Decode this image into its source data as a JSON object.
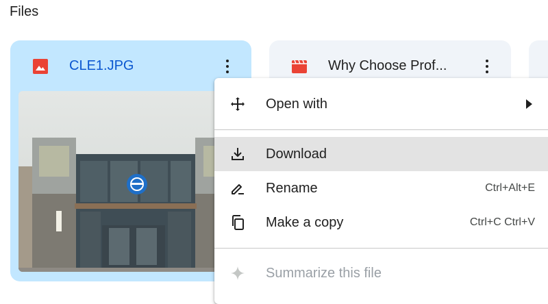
{
  "section": {
    "title": "Files"
  },
  "cards": [
    {
      "name": "CLE1.JPG",
      "type_icon": "image-file-icon",
      "more_icon": "more-vert-icon"
    },
    {
      "name": "Why Choose Prof...",
      "type_icon": "video-file-icon",
      "more_icon": "more-vert-icon"
    }
  ],
  "menu": {
    "items": [
      {
        "label": "Open with",
        "icon": "open-with-icon",
        "submenu": true
      },
      {
        "label": "Download",
        "icon": "download-icon",
        "highlighted": true
      },
      {
        "label": "Rename",
        "icon": "rename-icon",
        "shortcut": "Ctrl+Alt+E"
      },
      {
        "label": "Make a copy",
        "icon": "copy-icon",
        "shortcut": "Ctrl+C Ctrl+V"
      },
      {
        "label": "Summarize this file",
        "icon": "sparkle-icon",
        "disabled": true
      }
    ]
  },
  "colors": {
    "selected_card_bg": "#c2e7ff",
    "card_bg": "#f0f4f9",
    "image_icon": "#ea4335",
    "video_icon": "#ea4335",
    "hover_item_bg": "#e3e3e3"
  }
}
